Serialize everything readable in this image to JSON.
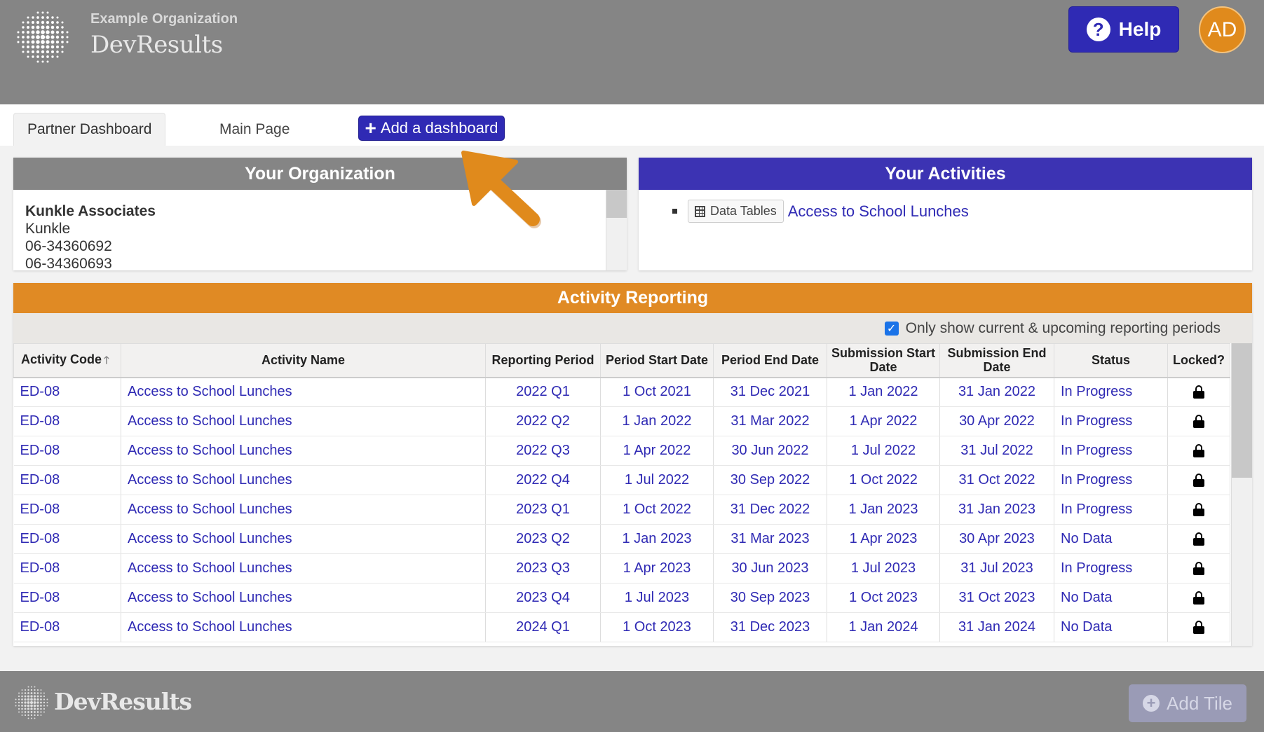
{
  "header": {
    "organization": "Example Organization",
    "app_name": "DevResults",
    "help_label": "Help",
    "avatar_initials": "AD"
  },
  "tabs": [
    {
      "label": "Partner Dashboard",
      "active": true
    },
    {
      "label": "Main Page",
      "active": false
    }
  ],
  "add_dashboard_label": "Add a dashboard",
  "your_organization": {
    "title": "Your Organization",
    "name": "Kunkle Associates",
    "lines": [
      "Kunkle",
      "06-34360692",
      "06-34360693"
    ]
  },
  "your_activities": {
    "title": "Your Activities",
    "data_tables_label": "Data Tables",
    "activity_link": "Access to School Lunches"
  },
  "activity_reporting": {
    "title": "Activity Reporting",
    "filter_label": "Only show current & upcoming reporting periods",
    "filter_checked": true,
    "columns": [
      "Activity Code",
      "Activity Name",
      "Reporting Period",
      "Period Start Date",
      "Period End Date",
      "Submission Start Date",
      "Submission End Date",
      "Status",
      "Locked?"
    ],
    "rows": [
      [
        "ED-08",
        "Access to School Lunches",
        "2022 Q1",
        "1 Oct 2021",
        "31 Dec 2021",
        "1 Jan 2022",
        "31 Jan 2022",
        "In Progress"
      ],
      [
        "ED-08",
        "Access to School Lunches",
        "2022 Q2",
        "1 Jan 2022",
        "31 Mar 2022",
        "1 Apr 2022",
        "30 Apr 2022",
        "In Progress"
      ],
      [
        "ED-08",
        "Access to School Lunches",
        "2022 Q3",
        "1 Apr 2022",
        "30 Jun 2022",
        "1 Jul 2022",
        "31 Jul 2022",
        "In Progress"
      ],
      [
        "ED-08",
        "Access to School Lunches",
        "2022 Q4",
        "1 Jul 2022",
        "30 Sep 2022",
        "1 Oct 2022",
        "31 Oct 2022",
        "In Progress"
      ],
      [
        "ED-08",
        "Access to School Lunches",
        "2023 Q1",
        "1 Oct 2022",
        "31 Dec 2022",
        "1 Jan 2023",
        "31 Jan 2023",
        "In Progress"
      ],
      [
        "ED-08",
        "Access to School Lunches",
        "2023 Q2",
        "1 Jan 2023",
        "31 Mar 2023",
        "1 Apr 2023",
        "30 Apr 2023",
        "No Data"
      ],
      [
        "ED-08",
        "Access to School Lunches",
        "2023 Q3",
        "1 Apr 2023",
        "30 Jun 2023",
        "1 Jul 2023",
        "31 Jul 2023",
        "In Progress"
      ],
      [
        "ED-08",
        "Access to School Lunches",
        "2023 Q4",
        "1 Jul 2023",
        "30 Sep 2023",
        "1 Oct 2023",
        "31 Oct 2023",
        "No Data"
      ],
      [
        "ED-08",
        "Access to School Lunches",
        "2024 Q1",
        "1 Oct 2023",
        "31 Dec 2023",
        "1 Jan 2024",
        "31 Jan 2024",
        "No Data"
      ]
    ]
  },
  "footer": {
    "brand": "DevResults",
    "add_tile_label": "Add Tile"
  },
  "colors": {
    "header_gray": "#858585",
    "primary_blue": "#2f2ab4",
    "activities_header": "#3c33b3",
    "reporting_orange": "#e08a24",
    "avatar_orange": "#e08a1c",
    "annotation_arrow": "#e08a1c"
  },
  "icons": [
    "globe-logo-icon",
    "help-question-icon",
    "plus-icon",
    "data-table-icon",
    "sort-up-icon",
    "lock-icon",
    "add-circle-icon",
    "annotation-arrow"
  ]
}
